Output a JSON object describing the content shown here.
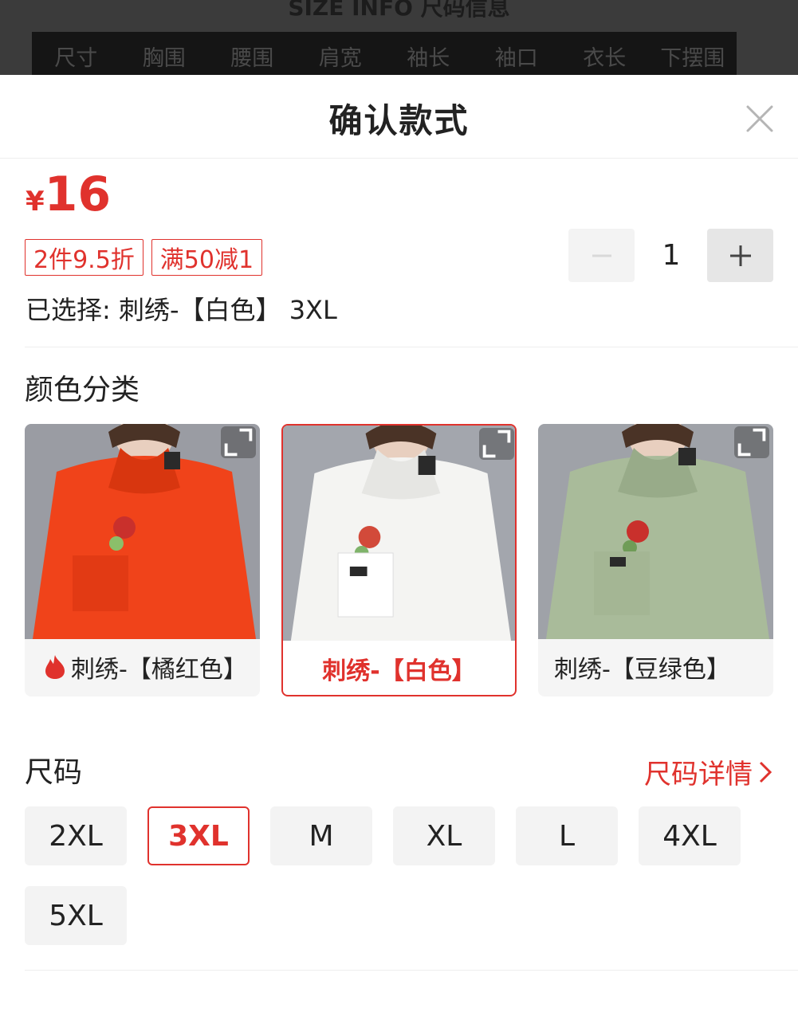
{
  "background": {
    "title": "SIZE INFO 尺码信息",
    "table_headers": [
      "尺寸",
      "胸围",
      "腰围",
      "肩宽",
      "袖长",
      "袖口",
      "衣长",
      "下摆围"
    ]
  },
  "sheet": {
    "title": "确认款式",
    "close_icon": "close-icon"
  },
  "price": {
    "currency": "¥",
    "amount": "16"
  },
  "promo_tags": [
    "2件9.5折",
    "满50减1"
  ],
  "selected": {
    "prefix": "已选择:",
    "value": "刺绣-【白色】 3XL"
  },
  "quantity": {
    "value": "1",
    "minus_icon": "minus-icon",
    "plus_icon": "plus-icon"
  },
  "color_section": {
    "title": "颜色分类",
    "options": [
      {
        "label": "刺绣-【橘红色】",
        "selected": false,
        "hot": true,
        "color": "#f0431a"
      },
      {
        "label": "刺绣-【白色】",
        "selected": true,
        "hot": false,
        "color": "#f4f4f2"
      },
      {
        "label": "刺绣-【豆绿色】",
        "selected": false,
        "hot": false,
        "color": "#a9bb9a"
      }
    ]
  },
  "size_section": {
    "title": "尺码",
    "guide_link": "尺码详情",
    "options": [
      "2XL",
      "3XL",
      "M",
      "XL",
      "L",
      "4XL",
      "5XL"
    ],
    "selected": "3XL"
  },
  "colors": {
    "accent": "#e0322d",
    "button_bg": "#f3f3f3"
  }
}
